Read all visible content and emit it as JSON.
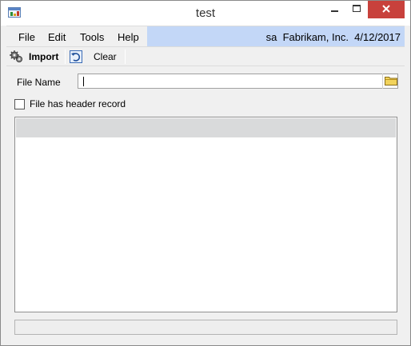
{
  "window": {
    "title": "test",
    "icons": {
      "app": "app-window-icon",
      "minimize": "minimize-icon",
      "maximize": "maximize-icon",
      "close": "close-icon"
    },
    "close_color": "#c8413c"
  },
  "menubar": {
    "items": [
      "File",
      "Edit",
      "Tools",
      "Help"
    ],
    "company_info": "sa  Fabrikam, Inc.  4/12/2017",
    "highlight_color": "#c3d7f7"
  },
  "toolbar": {
    "import_label": "Import",
    "import_icon": "gears-icon",
    "clear_label": "Clear",
    "clear_icon": "undo-icon"
  },
  "form": {
    "file_name_label": "File Name",
    "file_name_value": "",
    "browse_icon": "folder-icon",
    "header_checkbox_label": "File has header record",
    "header_checkbox_checked": false
  }
}
